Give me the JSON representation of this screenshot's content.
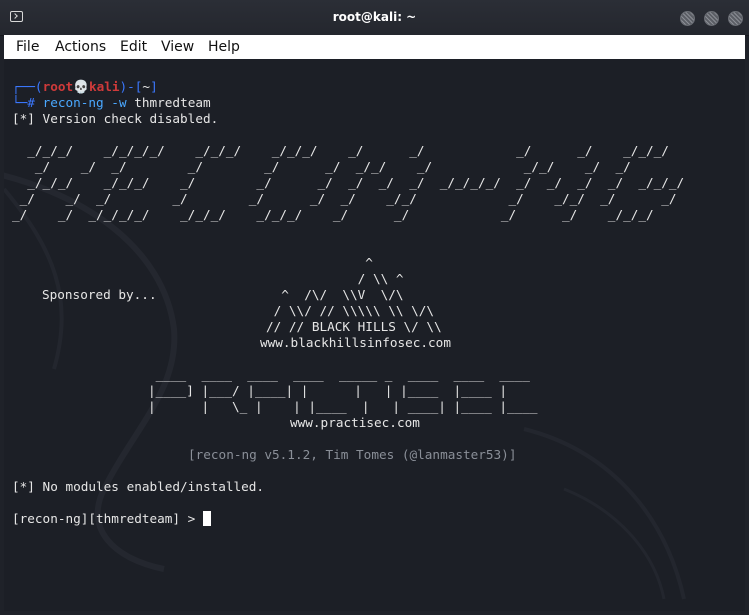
{
  "window": {
    "title": "root@kali: ~"
  },
  "menu": [
    "File",
    "Actions",
    "Edit",
    "View",
    "Help"
  ],
  "prompt": {
    "box_top": "┌──(",
    "user": "root",
    "skull": "💀",
    "host": "kali",
    "mid": ")-[",
    "dir": "~",
    "end": "]",
    "box_bottom": "└─",
    "hash": "# ",
    "cmd": "recon-ng",
    "flag": " -w ",
    "arg": "thmredteam"
  },
  "output": {
    "version_check": "[*] Version check disabled.",
    "recon_banner": "  _/_/_/    _/_/_/_/    _/_/_/    _/_/_/    _/      _/            _/      _/    _/_/_/\n   _/    _/  _/        _/        _/      _/  _/_/    _/            _/_/    _/  _/\n  _/_/_/    _/_/_/    _/        _/      _/  _/  _/  _/  _/_/_/_/  _/  _/  _/  _/  _/_/_/\n _/    _/  _/        _/        _/      _/  _/    _/_/            _/    _/_/  _/      _/\n_/    _/  _/_/_/_/    _/_/_/    _/_/_/    _/      _/            _/      _/    _/_/_/",
    "sponsored_by": "Sponsored by...",
    "bhis_art": "             ^\n            / \\\\ ^\n  ^  /\\/  \\\\V  \\/\\\n / \\\\/ // \\\\\\\\\\ \\\\ \\/\\\n// // BLACK HILLS \\/ \\\\",
    "bhis_url": "www.blackhillsinfosec.com",
    "practisec_art": " ____  ____  ____  ____  _____ _  ____  ____  ____\n|____] |___/ |____| |      |   | |____  |____ |\n|      |   \\_ |    | |____  |   | ____| |____ |____",
    "practisec_url": "www.practisec.com",
    "version": "[recon-ng v5.1.2, Tim Tomes (@lanmaster53)]",
    "no_modules": "[*] No modules enabled/installed.",
    "rng_prompt": "[recon-ng][thmredteam] > "
  },
  "colors": {
    "terminal_bg": "#1c1f26",
    "prompt_blue": "#3b78ff",
    "prompt_red": "#cf3a3a",
    "text": "#e6e6e6",
    "version_grey": "#8a8f98"
  }
}
